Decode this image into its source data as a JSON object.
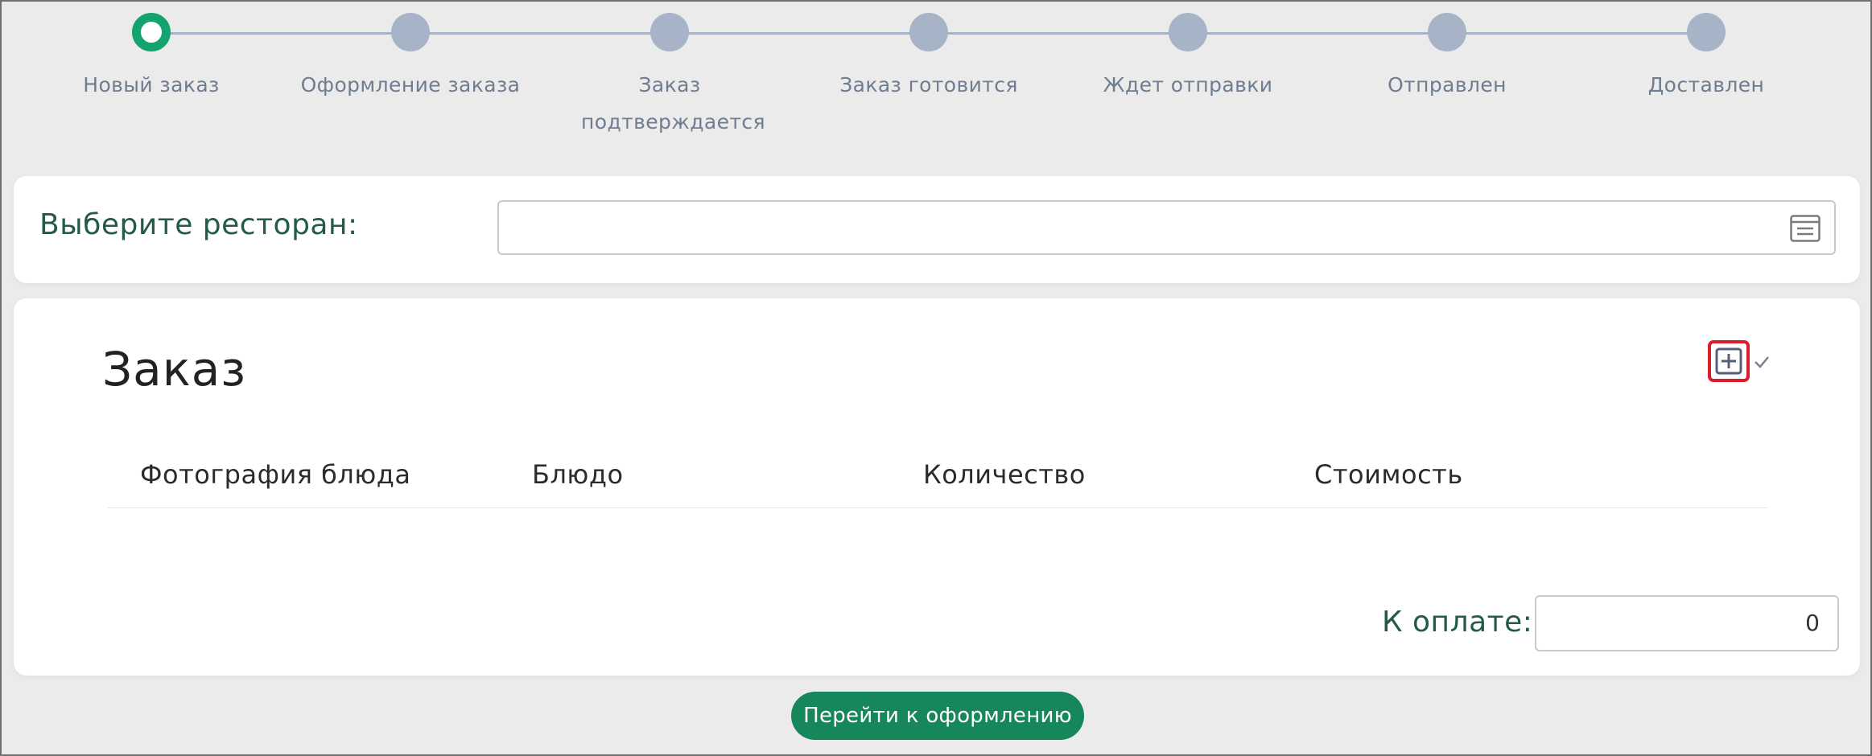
{
  "stepper": {
    "steps": [
      {
        "label": "Новый заказ",
        "state": "active"
      },
      {
        "label": "Оформление заказа",
        "state": "pending"
      },
      {
        "label": "Заказ подтверждается",
        "state": "pending"
      },
      {
        "label": "Заказ готовится",
        "state": "pending"
      },
      {
        "label": "Ждет отправки",
        "state": "pending"
      },
      {
        "label": "Отправлен",
        "state": "pending"
      },
      {
        "label": "Доставлен",
        "state": "pending"
      }
    ]
  },
  "restaurant": {
    "label": "Выберите ресторан:",
    "value": "",
    "icon": "list-icon"
  },
  "order": {
    "title": "Заказ",
    "add_icon": "plus-square-icon",
    "columns": [
      "Фотография блюда",
      "Блюдо",
      "Количество",
      "Стоимость"
    ],
    "rows": [],
    "total_label": "К оплате:",
    "total_value": "0"
  },
  "actions": {
    "submit_label": "Перейти к оформлению"
  },
  "colors": {
    "accent": "#13a36f",
    "button": "#16875a",
    "label_green": "#235b46",
    "step_inactive": "#a7b4c7",
    "highlight_red": "#dd1c2b"
  }
}
